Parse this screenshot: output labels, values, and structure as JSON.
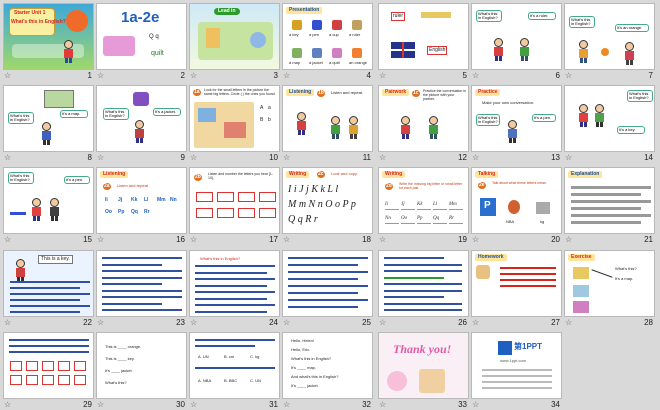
{
  "app": {
    "view": "slide-sorter",
    "total_slides": 34,
    "star_glyph": "☆"
  },
  "slides": [
    {
      "n": "1",
      "texts": [
        "Starter Unit 1",
        "What's this in English?"
      ]
    },
    {
      "n": "2",
      "texts": [
        "1a-2e",
        "Q q",
        "quilt"
      ]
    },
    {
      "n": "3",
      "texts": [
        "Lead in"
      ]
    },
    {
      "n": "4",
      "texts": [
        "Presentation",
        "a key",
        "a pen",
        "a cup",
        "a ruler",
        "a map",
        "a jacket",
        "a quilt",
        "an orange"
      ]
    },
    {
      "n": "5",
      "texts": [
        "ruler",
        "English"
      ]
    },
    {
      "n": "6",
      "texts": [
        "What's this in English?",
        "It's a ruler."
      ]
    },
    {
      "n": "7",
      "texts": [
        "What's this in English?",
        "It's an orange."
      ]
    },
    {
      "n": "8",
      "texts": [
        "What's this in English?",
        "It's a map."
      ]
    },
    {
      "n": "9",
      "texts": [
        "What's this in English?",
        "It's a jacket."
      ]
    },
    {
      "n": "10",
      "texts": [
        "1a",
        "Look for the small letters in the picture the same big letters. Circle ( ) the ones you found.",
        "A",
        "a",
        "B",
        "b"
      ]
    },
    {
      "n": "11",
      "texts": [
        "Listening",
        "1b",
        "Listen and repeat."
      ]
    },
    {
      "n": "12",
      "texts": [
        "Pairwork",
        "1c",
        "Practice the conversation in the picture with your partner."
      ]
    },
    {
      "n": "13",
      "texts": [
        "Practice",
        "Make your own conversation.",
        "It's a pen.",
        "What's this in English?"
      ]
    },
    {
      "n": "14",
      "texts": [
        "What's this in English?",
        "It's a key."
      ]
    },
    {
      "n": "15",
      "texts": [
        "What's this in English?",
        "It's a pen."
      ]
    },
    {
      "n": "16",
      "texts": [
        "Listening",
        "2a",
        "Listen and repeat",
        "Ii",
        "Jj",
        "Kk",
        "Ll",
        "Mm",
        "Nn",
        "Oo",
        "Pp",
        "Qq",
        "Rr"
      ]
    },
    {
      "n": "17",
      "texts": [
        "2b",
        "Listen and number the letters you hear [1-10]."
      ]
    },
    {
      "n": "18",
      "texts": [
        "Writing",
        "2c",
        "Look and copy.",
        "I i J j K k L l",
        "M m N n O o P p",
        "Q q R r"
      ]
    },
    {
      "n": "19",
      "texts": [
        "Writing",
        "2d",
        "Write the missing big letter or small letter for each pair.",
        "Ii",
        "Jj",
        "Kk",
        "Ll",
        "Mm",
        "Nn",
        "Oo",
        "Pp",
        "Qq",
        "Rr"
      ]
    },
    {
      "n": "20",
      "texts": [
        "Talking",
        "2e",
        "Talk about what these letters mean.",
        "P",
        "NBA",
        "kg"
      ]
    },
    {
      "n": "21",
      "texts": [
        "Explanation"
      ]
    },
    {
      "n": "22",
      "texts": [
        "This is a key."
      ]
    },
    {
      "n": "23",
      "texts": []
    },
    {
      "n": "24",
      "texts": [
        "What's this in English?"
      ]
    },
    {
      "n": "25",
      "texts": []
    },
    {
      "n": "26",
      "texts": []
    },
    {
      "n": "27",
      "texts": [
        "Homework"
      ]
    },
    {
      "n": "28",
      "texts": [
        "Exercise",
        "What's this?",
        "It's a map."
      ]
    },
    {
      "n": "29",
      "texts": []
    },
    {
      "n": "30",
      "texts": [
        "This is ____ orange.",
        "This is ____ key.",
        "It's ____ jacket.",
        "What's this?"
      ]
    },
    {
      "n": "31",
      "texts": [
        "A. UN",
        "B. cm",
        "C. kg",
        "A. NBA",
        "B. BBC",
        "C. UN"
      ]
    },
    {
      "n": "32",
      "texts": [
        "Hello, Helen!",
        "Hello, Eric.",
        "What's this in English?",
        "It's ____ map.",
        "And what's this in English?",
        "It's ____ jacket."
      ]
    },
    {
      "n": "33",
      "texts": [
        "Thank you!"
      ]
    },
    {
      "n": "34",
      "texts": [
        "第1PPT",
        "www.1ppt.com"
      ]
    }
  ],
  "colors": {
    "selected_border": "#3a6fd8",
    "title_red": "#d8251c",
    "accent_green": "#2b9b2b",
    "accent_blue": "#1e5fbf"
  }
}
